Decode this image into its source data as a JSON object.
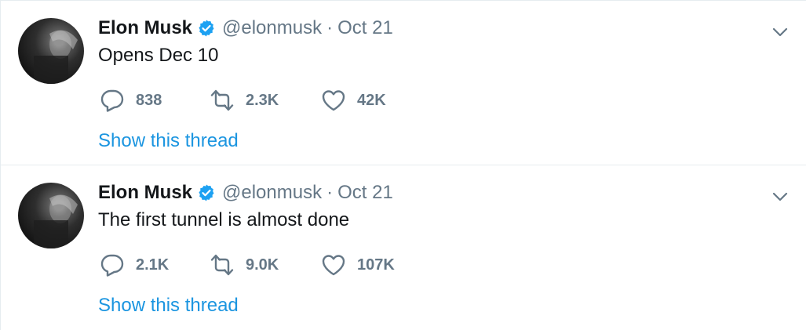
{
  "tweets": [
    {
      "name": "Elon Musk",
      "handle": "@elonmusk",
      "separator": "·",
      "date": "Oct 21",
      "text": "Opens Dec 10",
      "replies": "838",
      "retweets": "2.3K",
      "likes": "42K",
      "show_thread": "Show this thread"
    },
    {
      "name": "Elon Musk",
      "handle": "@elonmusk",
      "separator": "·",
      "date": "Oct 21",
      "text": "The first tunnel is almost done",
      "replies": "2.1K",
      "retweets": "9.0K",
      "likes": "107K",
      "show_thread": "Show this thread"
    }
  ],
  "icons": {
    "verified": "verified-badge-icon",
    "reply": "reply-icon",
    "retweet": "retweet-icon",
    "like": "heart-icon",
    "more": "chevron-down-icon"
  },
  "colors": {
    "text": "#14171a",
    "muted": "#657786",
    "link": "#1b95e0",
    "verified": "#1da1f2",
    "divider": "#e6ecf0"
  }
}
